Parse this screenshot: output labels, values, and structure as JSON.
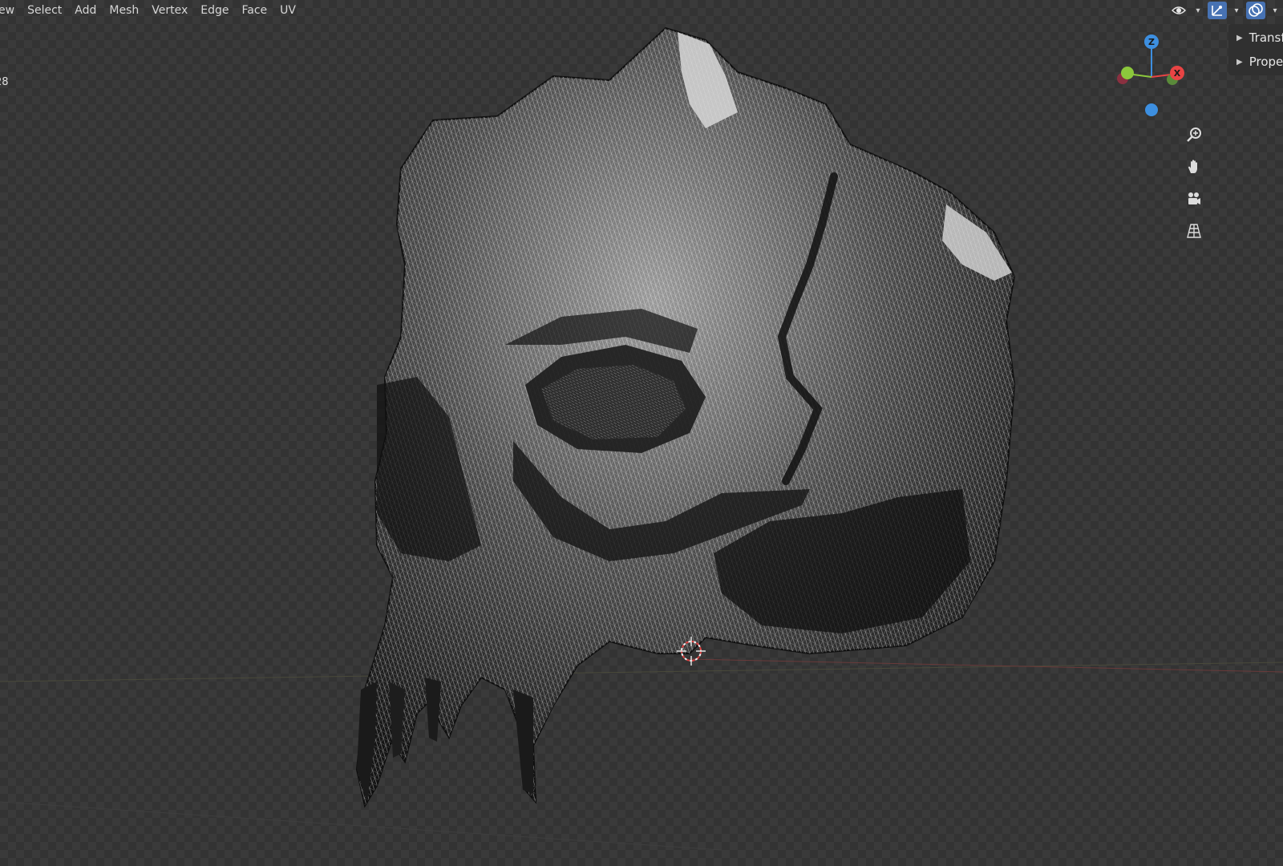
{
  "menubar": {
    "items": [
      "ew",
      "Select",
      "Add",
      "Mesh",
      "Vertex",
      "Edge",
      "Face",
      "UV"
    ]
  },
  "overlay": {
    "stat_text": "28"
  },
  "header_tools": {
    "icons": [
      "view-eye-icon",
      "gizmo-toggle-icon",
      "overlay-toggle-icon"
    ],
    "active_color": "#4772b3"
  },
  "sidebar_panel": {
    "sections": [
      "Transf",
      "Prope"
    ]
  },
  "navigation_gizmo": {
    "axes": {
      "z": "Z",
      "x": "X"
    },
    "colors": {
      "x": "#e84444",
      "y": "#8cc83c",
      "z": "#3d8fe0"
    }
  },
  "nav_tools": [
    "zoom-icon",
    "pan-hand-icon",
    "camera-icon",
    "ortho-grid-icon"
  ],
  "scene": {
    "object": "skull-mesh-wireframe",
    "cursor_icon": "3d-cursor-icon"
  }
}
